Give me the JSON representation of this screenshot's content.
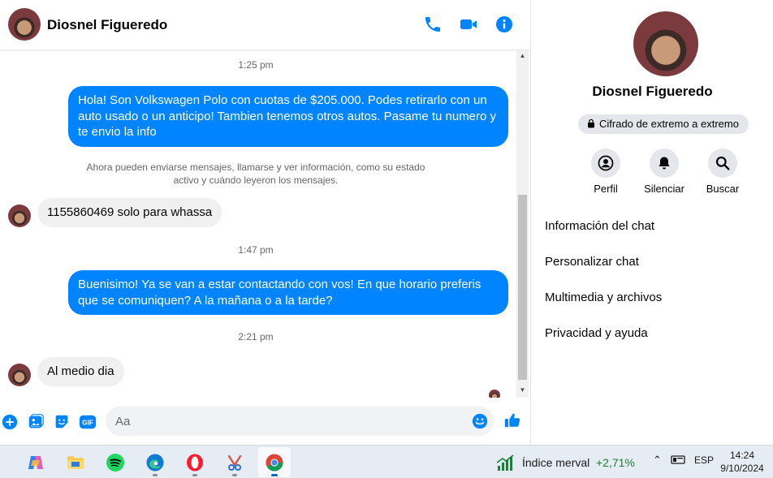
{
  "header": {
    "contact_name": "Diosnel Figueredo",
    "icons": [
      "phone-icon",
      "video-camera-icon",
      "info-icon"
    ]
  },
  "messages": [
    {
      "type": "timestamp",
      "text": "1:25 pm"
    },
    {
      "type": "outgoing",
      "text": "Hola! Son Volkswagen Polo con cuotas de $205.000. Podes retirarlo con un auto usado o un anticipo! Tambien tenemos otros autos. Pasame tu numero y te envio la info"
    },
    {
      "type": "notice",
      "text": "Ahora pueden enviarse mensajes, llamarse y ver información, como su estado activo y cuándo leyeron los mensajes."
    },
    {
      "type": "incoming",
      "text": "1155860469 solo para whassa"
    },
    {
      "type": "timestamp",
      "text": "1:47 pm"
    },
    {
      "type": "outgoing",
      "text": "Buenisimo! Ya se van a estar contactando con vos! En que horario preferis que se comuniquen? A la mañana o a la tarde?"
    },
    {
      "type": "timestamp",
      "text": "2:21 pm"
    },
    {
      "type": "incoming",
      "text": "Al medio dia"
    }
  ],
  "composer": {
    "placeholder": "Aa",
    "icons": [
      "plus-icon",
      "gallery-icon",
      "sticker-icon",
      "gif-icon",
      "emoji-icon",
      "thumbs-up-icon"
    ],
    "gif_label": "GIF"
  },
  "side_panel": {
    "contact_name": "Diosnel Figueredo",
    "encryption_label": "Cifrado de extremo a extremo",
    "actions": [
      {
        "label": "Perfil",
        "icon": "profile-icon"
      },
      {
        "label": "Silenciar",
        "icon": "bell-icon"
      },
      {
        "label": "Buscar",
        "icon": "search-icon"
      }
    ],
    "menu": [
      "Información del chat",
      "Personalizar chat",
      "Multimedia y archivos",
      "Privacidad y ayuda"
    ]
  },
  "taskbar": {
    "apps": [
      "copilot-icon",
      "file-explorer-icon",
      "spotify-icon",
      "edge-icon",
      "opera-icon",
      "snipping-tool-icon",
      "chrome-icon"
    ],
    "stock_name": "Índice merval",
    "stock_change": "+2,71%",
    "language": "ESP",
    "time": "14:24",
    "date": "9/10/2024"
  },
  "colors": {
    "messenger_blue": "#0084ff",
    "accent": "#0084ff",
    "stock_up": "#1a7f37"
  }
}
